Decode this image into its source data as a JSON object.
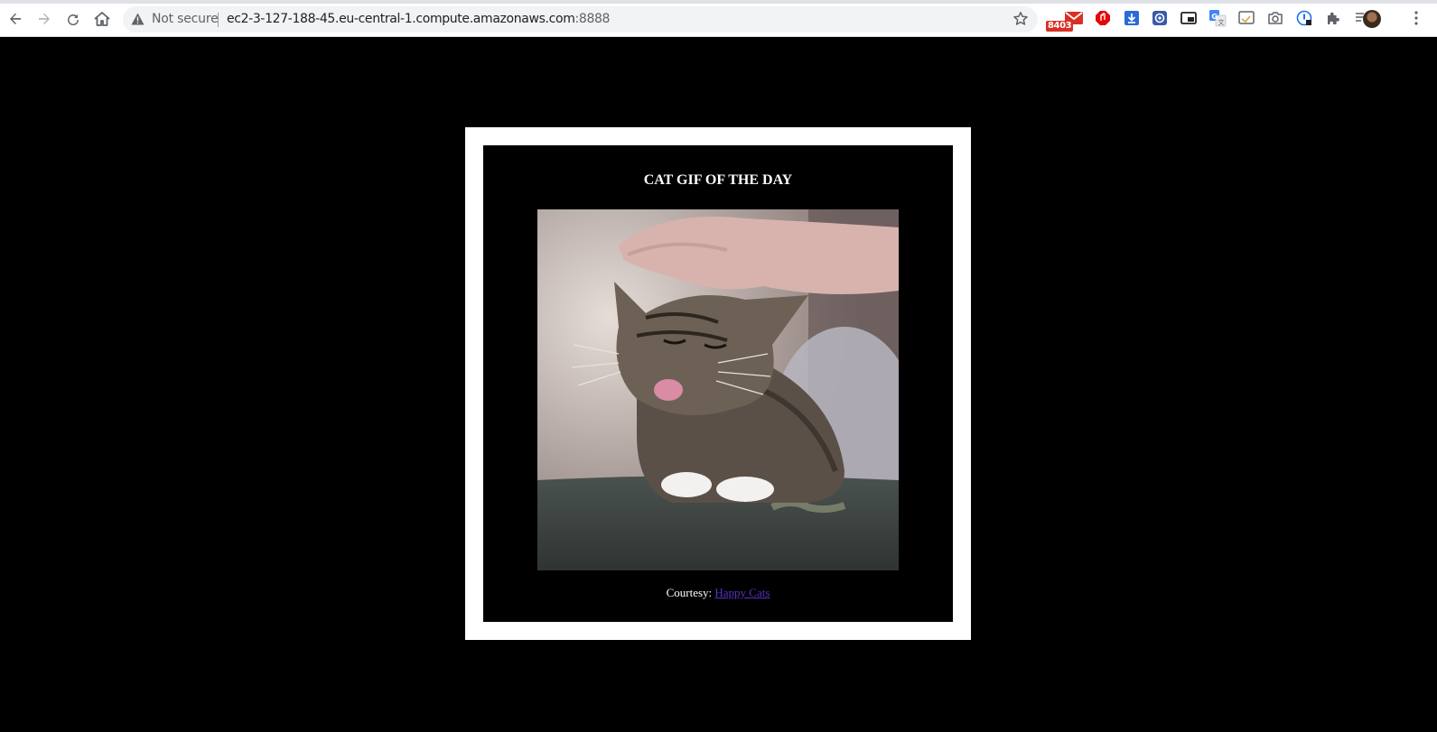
{
  "browser": {
    "security_label": "Not secure",
    "url_host": "ec2-3-127-188-45.eu-central-1.compute.amazonaws.com",
    "url_port": ":8888",
    "mail_badge": "8403",
    "icons": [
      "back-icon",
      "forward-icon",
      "reload-icon",
      "home-icon",
      "warning-icon",
      "star-icon",
      "gmail-extension-icon",
      "adblock-extension-icon",
      "download-extension-icon",
      "puzzle-extension-icon",
      "picture-in-picture-icon",
      "translate-icon",
      "cast-icon",
      "camera-icon",
      "password-icon",
      "extensions-icon",
      "media-control-icon",
      "profile-avatar",
      "menu-icon"
    ]
  },
  "page": {
    "heading": "CAT GIF OF THE DAY",
    "image_alt": "cat gif",
    "courtesy_label": "Courtesy:",
    "courtesy_link": "Happy Cats"
  },
  "colors": {
    "page_background": "#000000",
    "frame_border": "#ffffff",
    "link_visited": "#5b2fc4"
  }
}
